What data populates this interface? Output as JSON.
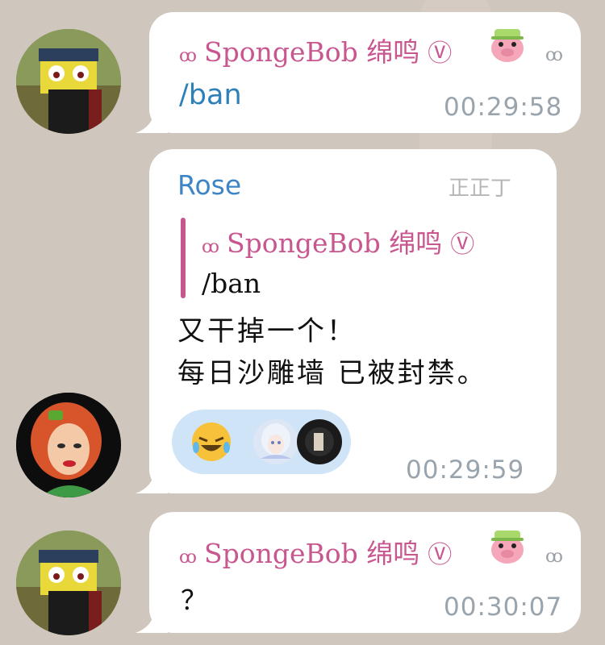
{
  "messages": [
    {
      "sender": "SpongeBob 绵鸣",
      "sender_prefix": "ꝏ",
      "verified": "Ⓥ",
      "text": "/ban",
      "time": "00:29:58",
      "status_suffix": "ꝏ"
    },
    {
      "sender": "Rose",
      "sender_tag": "正正丁",
      "quote": {
        "sender_prefix": "ꝏ",
        "sender": "SpongeBob 绵鸣",
        "verified": "Ⓥ",
        "text": "/ban"
      },
      "lines": [
        "又干掉一个！",
        "每日沙雕墙 已被封禁。"
      ],
      "reactions": [
        "rofl-emoji",
        "anime-girl-avatar",
        "dark-avatar"
      ],
      "time": "00:29:59"
    },
    {
      "sender": "SpongeBob 绵鸣",
      "sender_prefix": "ꝏ",
      "verified": "Ⓥ",
      "text": "？",
      "time": "00:30:07",
      "status_suffix": "ꝏ"
    }
  ],
  "colors": {
    "background": "#cfc6bd",
    "bubble": "#ffffff",
    "sender_pink": "#c8568f",
    "rose_blue": "#3d85c6",
    "command_blue": "#2f7fb8",
    "time_gray": "#9aa4ad",
    "reaction_bg": "#cfe4f6"
  }
}
